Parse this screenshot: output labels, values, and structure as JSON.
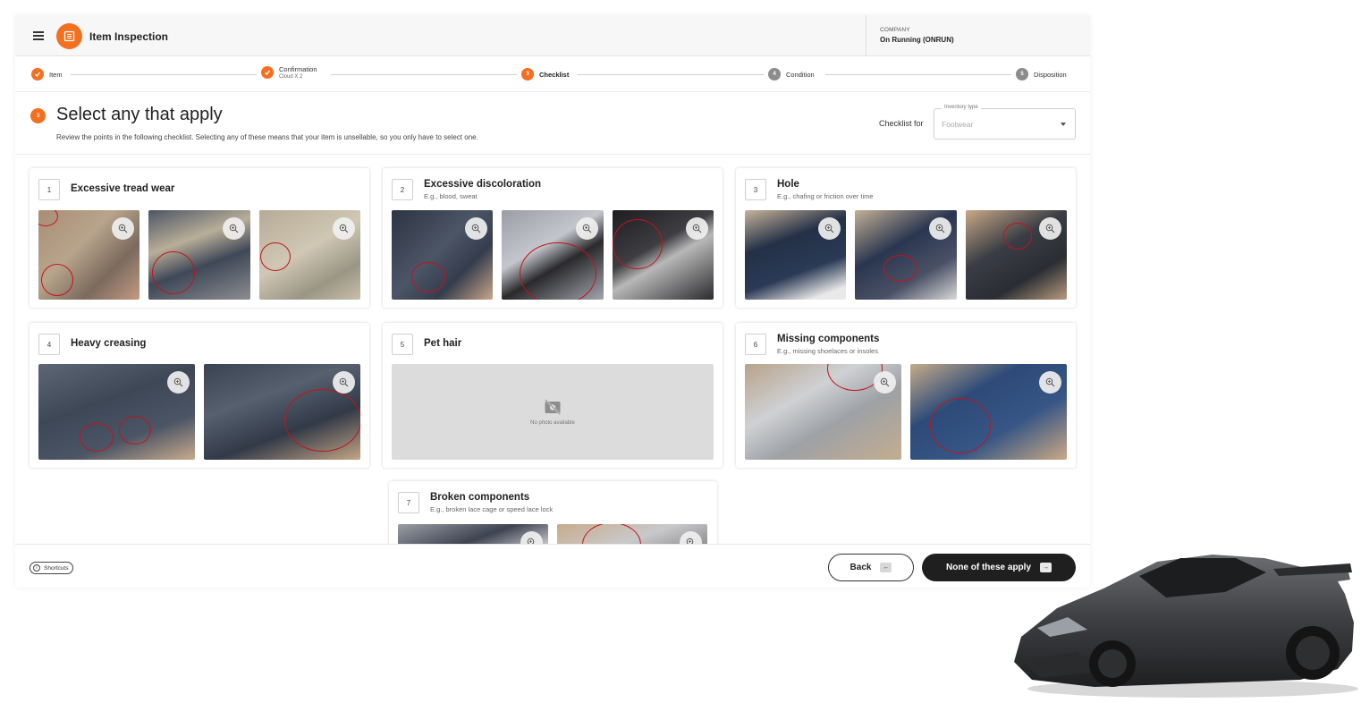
{
  "header": {
    "title": "Item Inspection",
    "company_label": "COMPANY",
    "company_name": "On Running (ONRUN)"
  },
  "stepper": {
    "steps": [
      {
        "number": "1",
        "label": "Item",
        "sub": "",
        "state": "done"
      },
      {
        "number": "2",
        "label": "Confirmation",
        "sub": "Cloud X 2",
        "state": "done"
      },
      {
        "number": "3",
        "label": "Checklist",
        "sub": "",
        "state": "active"
      },
      {
        "number": "4",
        "label": "Condition",
        "sub": "",
        "state": "todo"
      },
      {
        "number": "5",
        "label": "Disposition",
        "sub": "",
        "state": "todo"
      }
    ]
  },
  "main": {
    "step_badge": "3",
    "title": "Select any that apply",
    "description": "Review the points in the following checklist. Selecting any of these means that your item is unsellable, so you only have to select one.",
    "checklist_for_label": "Checklist for",
    "inventory_type_label": "Inventory type",
    "inventory_type_value": "Footwear"
  },
  "checklist": [
    {
      "number": "1",
      "title": "Excessive tread wear",
      "subtitle": ""
    },
    {
      "number": "2",
      "title": "Excessive discoloration",
      "subtitle": "E.g., blood, sweat"
    },
    {
      "number": "3",
      "title": "Hole",
      "subtitle": "E.g., chafing or friction over time"
    },
    {
      "number": "4",
      "title": "Heavy creasing",
      "subtitle": ""
    },
    {
      "number": "5",
      "title": "Pet hair",
      "subtitle": "",
      "no_photo_text": "No photo available"
    },
    {
      "number": "6",
      "title": "Missing components",
      "subtitle": "E.g., missing shoelaces or insoles"
    },
    {
      "number": "7",
      "title": "Broken components",
      "subtitle": "E.g., broken lace cage or speed lace lock"
    }
  ],
  "footer": {
    "shortcuts_label": "Shortcuts",
    "back_label": "Back",
    "back_key": "←",
    "none_label": "None of these apply",
    "none_key": "→"
  },
  "colors": {
    "accent": "#f37021",
    "primary_button": "#1f1f1f",
    "annotation_circle": "#c0141b"
  },
  "icons": [
    "menu-icon",
    "inspection-icon",
    "check-icon",
    "zoom-in-icon",
    "no-photo-icon",
    "info-icon",
    "dropdown-caret-icon"
  ]
}
